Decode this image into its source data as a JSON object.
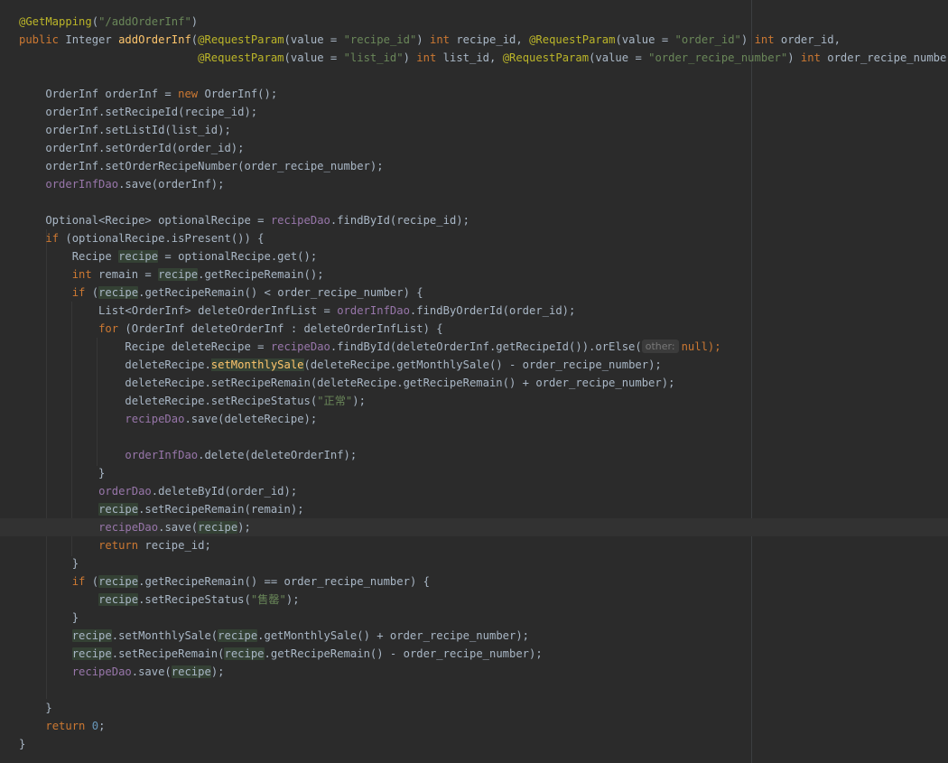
{
  "editor": {
    "tokens": {
      "annotation_getmapping": "@GetMapping",
      "annotation_requestparam": "@RequestParam",
      "kw_public": "public",
      "kw_int": "int",
      "kw_new": "new",
      "kw_if": "if",
      "kw_for": "for",
      "kw_return": "return",
      "str_route": "\"/addOrderInf\"",
      "str_recipe_id": "\"recipe_id\"",
      "str_order_id": "\"order_id\"",
      "str_list_id": "\"list_id\"",
      "str_order_recipe_number": "\"order_recipe_number\"",
      "str_status_normal": "\"正常\"",
      "str_status_soldout": "\"售罄\"",
      "method_name": "addOrderInf",
      "field_orderInfDao": "orderInfDao",
      "field_recipeDao": "recipeDao",
      "field_orderDao": "orderDao",
      "var_recipe": "recipe",
      "m_setMonthlySale": "setMonthlySale",
      "hint_other": "other:",
      "num_zero": "0"
    },
    "lines": {
      "l2a": "Integer ",
      "l2b": "(",
      "l2c": "(value = ",
      "l2d": ") ",
      "l2e": " recipe_id, ",
      "l2f": "(value = ",
      "l2g": ") ",
      "l2h": " order_id,",
      "l3a": "                           ",
      "l3b": "(value = ",
      "l3c": ") ",
      "l3d": " list_id, ",
      "l3e": "(value = ",
      "l3f": ") ",
      "l3g": " order_recipe_number) {",
      "l5a": "    OrderInf orderInf = ",
      "l5b": " OrderInf();",
      "l6": "    orderInf.setRecipeId(recipe_id);",
      "l7": "    orderInf.setListId(list_id);",
      "l8": "    orderInf.setOrderId(order_id);",
      "l9": "    orderInf.setOrderRecipeNumber(order_recipe_number);",
      "l10": ".save(orderInf);",
      "l12a": "    Optional<Recipe> optionalRecipe = ",
      "l12b": ".findById(recipe_id);",
      "l13": " (optionalRecipe.isPresent()) {",
      "l14a": "        Recipe ",
      "l14b": " = optionalRecipe.get();",
      "l15a": " remain = ",
      "l15b": ".getRecipeRemain();",
      "l16a": " (",
      "l16b": ".getRecipeRemain() < order_recipe_number) {",
      "l17a": "            List<OrderInf> deleteOrderInfList = ",
      "l17b": ".findByOrderId(order_id);",
      "l18": " (OrderInf deleteOrderInf : deleteOrderInfList) {",
      "l19a": "                Recipe deleteRecipe = ",
      "l19b": ".findById(deleteOrderInf.getRecipeId()).orElse(",
      "l19c": "null);",
      "l20a": "                deleteRecipe.",
      "l20b": "(deleteRecipe.getMonthlySale() - order_recipe_number);",
      "l21": "                deleteRecipe.setRecipeRemain(deleteRecipe.getRecipeRemain() + order_recipe_number);",
      "l22a": "                deleteRecipe.setRecipeStatus(",
      "l22b": ");",
      "l23": ".save(deleteRecipe);",
      "l25": ".delete(deleteOrderInf);",
      "l26": "            }",
      "l27": ".deleteById(order_id);",
      "l28": ".setRecipeRemain(remain);",
      "l29a": ".save(",
      "l29b": ");",
      "l30": " recipe_id;",
      "l31": "        }",
      "l32a": " (",
      "l32b": ".getRecipeRemain() == order_recipe_number) {",
      "l33a": ".setRecipeStatus(",
      "l33b": ");",
      "l34": "        }",
      "l35a": ".setMonthlySale(",
      "l35b": ".getMonthlySale() + order_recipe_number);",
      "l36a": ".setRecipeRemain(",
      "l36b": ".getRecipeRemain() - order_recipe_number);",
      "l37a": ".save(",
      "l37b": ");",
      "l39": "    }",
      "l40": ";",
      "l41": "}"
    }
  }
}
